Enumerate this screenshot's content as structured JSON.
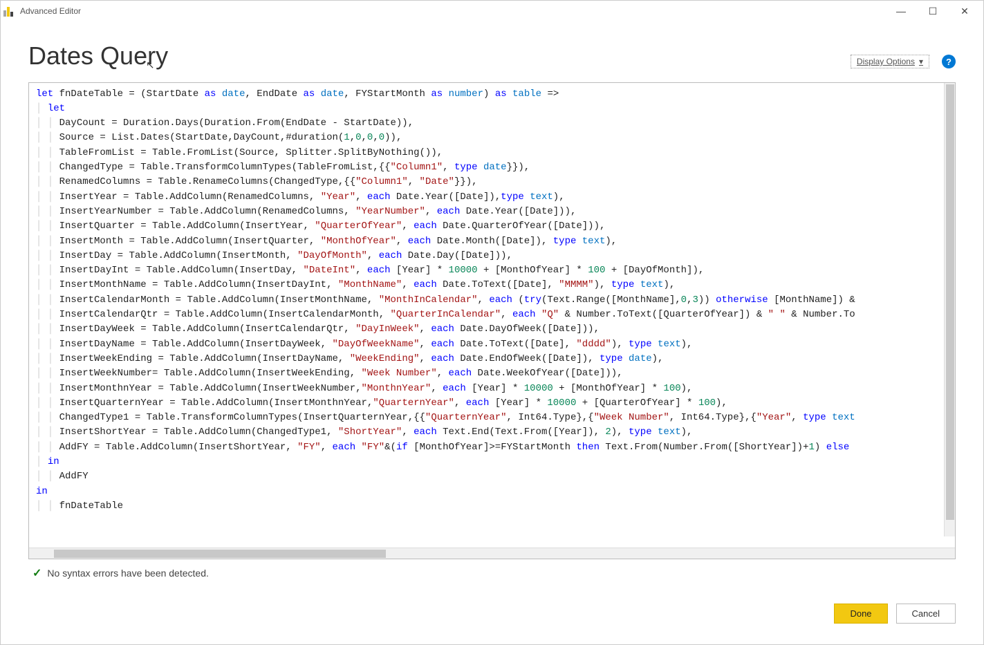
{
  "window": {
    "title": "Advanced Editor"
  },
  "header": {
    "page_title": "Dates Query",
    "display_options_label": "Display Options",
    "help_tooltip": "?"
  },
  "status": {
    "message": "No syntax errors have been detected."
  },
  "buttons": {
    "done": "Done",
    "cancel": "Cancel"
  },
  "code_lines": [
    "let fnDateTable = (StartDate as date, EndDate as date, FYStartMonth as number) as table =>",
    "  let",
    "    DayCount = Duration.Days(Duration.From(EndDate - StartDate)),",
    "    Source = List.Dates(StartDate,DayCount,#duration(1,0,0,0)),",
    "    TableFromList = Table.FromList(Source, Splitter.SplitByNothing()),",
    "    ChangedType = Table.TransformColumnTypes(TableFromList,{{\"Column1\", type date}}),",
    "    RenamedColumns = Table.RenameColumns(ChangedType,{{\"Column1\", \"Date\"}}),",
    "    InsertYear = Table.AddColumn(RenamedColumns, \"Year\", each Date.Year([Date]),type text),",
    "    InsertYearNumber = Table.AddColumn(RenamedColumns, \"YearNumber\", each Date.Year([Date])),",
    "    InsertQuarter = Table.AddColumn(InsertYear, \"QuarterOfYear\", each Date.QuarterOfYear([Date])),",
    "    InsertMonth = Table.AddColumn(InsertQuarter, \"MonthOfYear\", each Date.Month([Date]), type text),",
    "    InsertDay = Table.AddColumn(InsertMonth, \"DayOfMonth\", each Date.Day([Date])),",
    "    InsertDayInt = Table.AddColumn(InsertDay, \"DateInt\", each [Year] * 10000 + [MonthOfYear] * 100 + [DayOfMonth]),",
    "    InsertMonthName = Table.AddColumn(InsertDayInt, \"MonthName\", each Date.ToText([Date], \"MMMM\"), type text),",
    "    InsertCalendarMonth = Table.AddColumn(InsertMonthName, \"MonthInCalendar\", each (try(Text.Range([MonthName],0,3)) otherwise [MonthName]) &",
    "    InsertCalendarQtr = Table.AddColumn(InsertCalendarMonth, \"QuarterInCalendar\", each \"Q\" & Number.ToText([QuarterOfYear]) & \" \" & Number.To",
    "    InsertDayWeek = Table.AddColumn(InsertCalendarQtr, \"DayInWeek\", each Date.DayOfWeek([Date])),",
    "    InsertDayName = Table.AddColumn(InsertDayWeek, \"DayOfWeekName\", each Date.ToText([Date], \"dddd\"), type text),",
    "    InsertWeekEnding = Table.AddColumn(InsertDayName, \"WeekEnding\", each Date.EndOfWeek([Date]), type date),",
    "    InsertWeekNumber= Table.AddColumn(InsertWeekEnding, \"Week Number\", each Date.WeekOfYear([Date])),",
    "    InsertMonthnYear = Table.AddColumn(InsertWeekNumber,\"MonthnYear\", each [Year] * 10000 + [MonthOfYear] * 100),",
    "    InsertQuarternYear = Table.AddColumn(InsertMonthnYear,\"QuarternYear\", each [Year] * 10000 + [QuarterOfYear] * 100),",
    "    ChangedType1 = Table.TransformColumnTypes(InsertQuarternYear,{{\"QuarternYear\", Int64.Type},{\"Week Number\", Int64.Type},{\"Year\", type text",
    "    InsertShortYear = Table.AddColumn(ChangedType1, \"ShortYear\", each Text.End(Text.From([Year]), 2), type text),",
    "    AddFY = Table.AddColumn(InsertShortYear, \"FY\", each \"FY\"&(if [MonthOfYear]>=FYStartMonth then Text.From(Number.From([ShortYear])+1) else",
    "  in",
    "    AddFY",
    "in",
    "    fnDateTable"
  ]
}
